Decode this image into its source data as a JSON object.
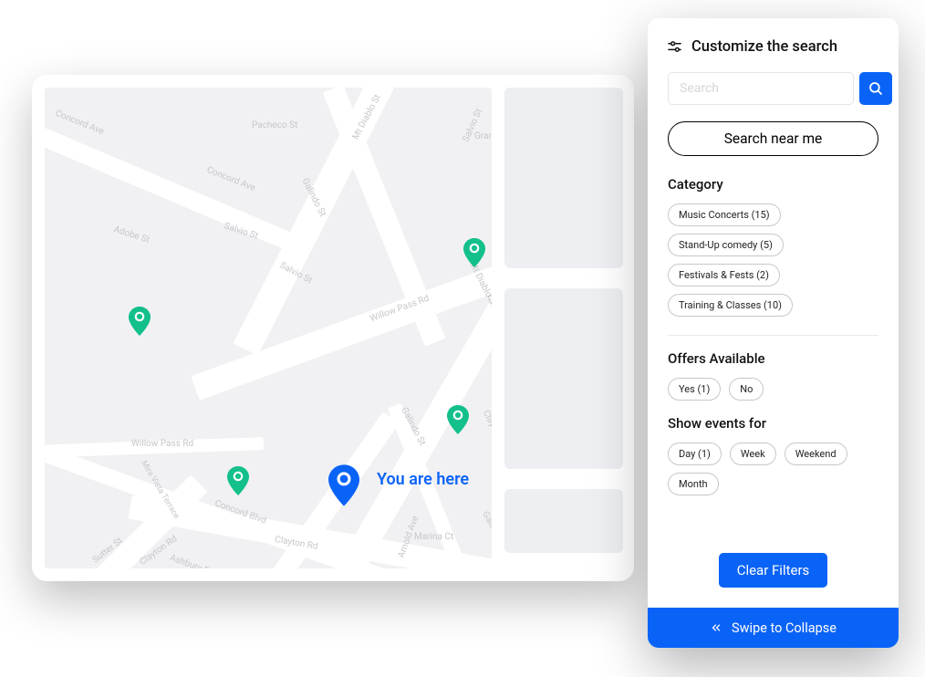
{
  "panel": {
    "title": "Customize the search",
    "search_placeholder": "Search",
    "near_label": "Search near me",
    "category": {
      "heading": "Category",
      "chips": [
        "Music Concerts (15)",
        "Stand-Up comedy (5)",
        "Festivals & Fests (2)",
        "Training & Classes (10)"
      ]
    },
    "offers": {
      "heading": "Offers Available",
      "chips": [
        "Yes (1)",
        "No"
      ]
    },
    "events": {
      "heading": "Show events for",
      "chips": [
        "Day (1)",
        "Week",
        "Weekend",
        "Month"
      ]
    },
    "clear_label": "Clear Filters",
    "swipe_label": "Swipe to Collapse"
  },
  "map": {
    "here_label": "You are here",
    "streets": {
      "concord_ave": "Concord Ave",
      "adobe": "Adobe St",
      "pacheco": "Pacheco St",
      "mt_diablo": "Mt Diablo St",
      "salvio": "Salvio St",
      "grant": "Grant St",
      "galindo": "Galindo St",
      "willow": "Willow Pass Rd",
      "mira": "Mira Vista Terrace",
      "concord_blvd": "Concord Blvd",
      "clayton": "Clayton Rd",
      "sutter": "Sutter St",
      "ashbury": "Ashbury Dr",
      "arnold": "Arnold Ave",
      "marina": "Marina Ct"
    }
  }
}
